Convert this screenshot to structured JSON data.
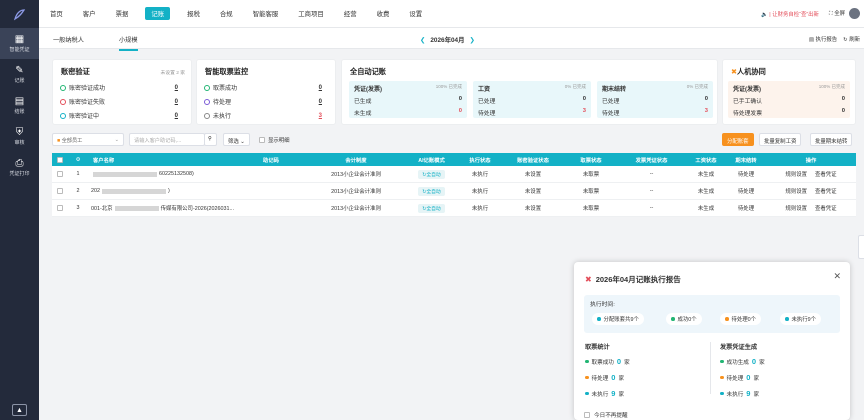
{
  "sidebar": {
    "items": [
      {
        "label": "智能凭证",
        "icon": "document-icon"
      },
      {
        "label": "记账",
        "icon": "edit-icon"
      },
      {
        "label": "结账",
        "icon": "ledger-icon"
      },
      {
        "label": "审核",
        "icon": "shield-icon"
      },
      {
        "label": "凭证打印",
        "icon": "print-icon"
      }
    ]
  },
  "topnav": {
    "items": [
      "首页",
      "客户",
      "票据",
      "记账",
      "报税",
      "合规",
      "智能客服",
      "工商项目",
      "经营",
      "收费",
      "设置"
    ],
    "active": "记账",
    "notice": "让财务自检“查”出新",
    "fullscreen": "全屏"
  },
  "subbar": {
    "tabs": [
      "一般纳税人",
      "小规模"
    ],
    "active_tab": "小规模",
    "period": "2026年04月",
    "report_btn": "执行报告",
    "refresh_btn": "刷新"
  },
  "cards": {
    "account": {
      "title": "账密验证",
      "note": "未设置 2 家",
      "rows": [
        {
          "label": "账密验证成功",
          "value": "0"
        },
        {
          "label": "账密验证失败",
          "value": "0"
        },
        {
          "label": "账密验证中",
          "value": "0"
        }
      ]
    },
    "ticket": {
      "title": "智能取票监控",
      "rows": [
        {
          "label": "取票成功",
          "value": "0"
        },
        {
          "label": "待处理",
          "value": "0"
        },
        {
          "label": "未执行",
          "value": "3"
        }
      ]
    },
    "auto": {
      "title": "全自动记账",
      "subs": [
        {
          "title": "凭证(发票)",
          "pct": "100% 已完成",
          "rows": [
            {
              "label": "已生成",
              "value": "0"
            },
            {
              "label": "未生成",
              "value": "0"
            }
          ]
        },
        {
          "title": "工资",
          "pct": "0% 已完成",
          "rows": [
            {
              "label": "已处理",
              "value": "0"
            },
            {
              "label": "待处理",
              "value": "3"
            }
          ]
        },
        {
          "title": "期末结转",
          "pct": "0% 已完成",
          "rows": [
            {
              "label": "已处理",
              "value": "0"
            },
            {
              "label": "待处理",
              "value": "3"
            }
          ]
        }
      ]
    },
    "human": {
      "title": "人机协同",
      "sub": {
        "title": "凭证(发票)",
        "pct": "100% 已完成",
        "rows": [
          {
            "label": "已手工确认",
            "value": "0"
          },
          {
            "label": "待处理发票",
            "value": "0"
          }
        ]
      }
    }
  },
  "toolbar": {
    "staff": "全部员工",
    "search_placeholder": "请输入客户助记码,...",
    "filter": "筛选",
    "show_detail": "显示明细",
    "btn_allocate": "分配账套",
    "btn_copy_salary": "批量复制工资",
    "btn_batch_close": "批量期末结转"
  },
  "table": {
    "headers": [
      "",
      "",
      "客户名称",
      "助记码",
      "会计制度",
      "AI记账模式",
      "执行状态",
      "账密验证状态",
      "取票状态",
      "发票凭证状态",
      "工资状态",
      "期末结转",
      "操作"
    ],
    "rows": [
      {
        "no": "1",
        "name_prefix": "",
        "name_suffix": "60225132508)",
        "code": "",
        "system": "2013小企业会计准则",
        "mode": "全自动",
        "exec": "未执行",
        "verify": "未设置",
        "ticket": "未取票",
        "invoice": "--",
        "salary": "未生成",
        "close": "待处理",
        "op1": "规则设置",
        "op2": "查看凭证"
      },
      {
        "no": "2",
        "name_prefix": "202",
        "name_suffix": ")",
        "code": "",
        "system": "2013小企业会计准则",
        "mode": "全自动",
        "exec": "未执行",
        "verify": "未设置",
        "ticket": "未取票",
        "invoice": "--",
        "salary": "未生成",
        "close": "待处理",
        "op1": "规则设置",
        "op2": "查看凭证"
      },
      {
        "no": "3",
        "name_prefix": "001-北京",
        "name_suffix": "传媒有限公司-2026(2026031...",
        "code": "",
        "system": "2013小企业会计准则",
        "mode": "全自动",
        "exec": "未执行",
        "verify": "未设置",
        "ticket": "未取票",
        "invoice": "--",
        "salary": "未生成",
        "close": "待处理",
        "op1": "规则设置",
        "op2": "查看凭证"
      }
    ]
  },
  "popup": {
    "title": "2026年04月记账执行报告",
    "exec_label": "执行时间:",
    "pills": [
      {
        "label": "分配账套共9个",
        "color": "#13b1c6"
      },
      {
        "label": "成功0个",
        "color": "#22b573"
      },
      {
        "label": "待处理0个",
        "color": "#f7911e"
      },
      {
        "label": "未执行9个",
        "color": "#13b1c6"
      }
    ],
    "left_title": "取票统计",
    "left": [
      {
        "label": "取票成功",
        "value": "0",
        "unit": "家",
        "color": "#22b573"
      },
      {
        "label": "待处理",
        "value": "0",
        "unit": "家",
        "color": "#f7911e"
      },
      {
        "label": "未执行",
        "value": "9",
        "unit": "家",
        "color": "#13b1c6"
      }
    ],
    "right_title": "发票凭证生成",
    "right": [
      {
        "label": "成功生成",
        "value": "0",
        "unit": "家",
        "color": "#22b573"
      },
      {
        "label": "待处理",
        "value": "0",
        "unit": "家",
        "color": "#f7911e"
      },
      {
        "label": "未执行",
        "value": "9",
        "unit": "家",
        "color": "#13b1c6"
      }
    ],
    "footer": "今日不再提醒"
  },
  "colors": {
    "accent": "#13b1c6",
    "orange": "#f7911e",
    "red": "#e34d59",
    "green": "#22b573"
  }
}
